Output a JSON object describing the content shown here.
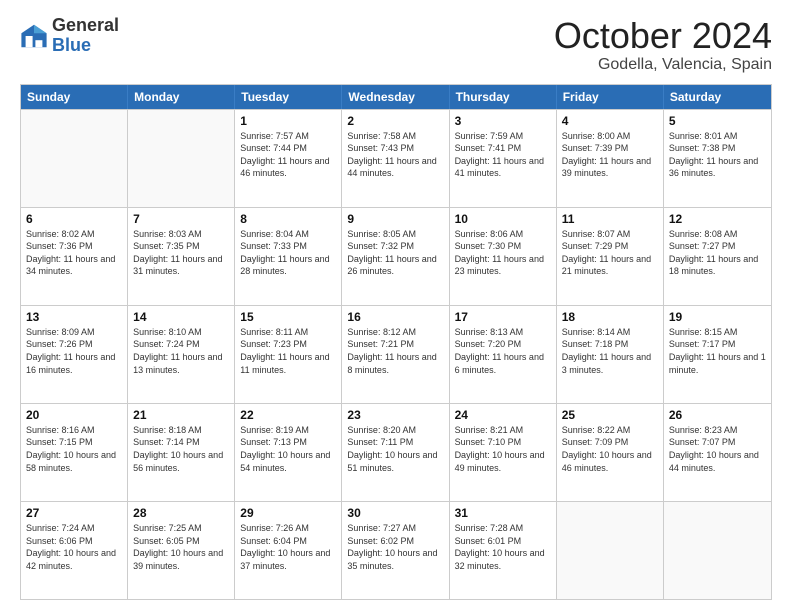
{
  "logo": {
    "general": "General",
    "blue": "Blue"
  },
  "title": "October 2024",
  "location": "Godella, Valencia, Spain",
  "header_days": [
    "Sunday",
    "Monday",
    "Tuesday",
    "Wednesday",
    "Thursday",
    "Friday",
    "Saturday"
  ],
  "rows": [
    [
      {
        "day": "",
        "info": ""
      },
      {
        "day": "",
        "info": ""
      },
      {
        "day": "1",
        "info": "Sunrise: 7:57 AM\nSunset: 7:44 PM\nDaylight: 11 hours and 46 minutes."
      },
      {
        "day": "2",
        "info": "Sunrise: 7:58 AM\nSunset: 7:43 PM\nDaylight: 11 hours and 44 minutes."
      },
      {
        "day": "3",
        "info": "Sunrise: 7:59 AM\nSunset: 7:41 PM\nDaylight: 11 hours and 41 minutes."
      },
      {
        "day": "4",
        "info": "Sunrise: 8:00 AM\nSunset: 7:39 PM\nDaylight: 11 hours and 39 minutes."
      },
      {
        "day": "5",
        "info": "Sunrise: 8:01 AM\nSunset: 7:38 PM\nDaylight: 11 hours and 36 minutes."
      }
    ],
    [
      {
        "day": "6",
        "info": "Sunrise: 8:02 AM\nSunset: 7:36 PM\nDaylight: 11 hours and 34 minutes."
      },
      {
        "day": "7",
        "info": "Sunrise: 8:03 AM\nSunset: 7:35 PM\nDaylight: 11 hours and 31 minutes."
      },
      {
        "day": "8",
        "info": "Sunrise: 8:04 AM\nSunset: 7:33 PM\nDaylight: 11 hours and 28 minutes."
      },
      {
        "day": "9",
        "info": "Sunrise: 8:05 AM\nSunset: 7:32 PM\nDaylight: 11 hours and 26 minutes."
      },
      {
        "day": "10",
        "info": "Sunrise: 8:06 AM\nSunset: 7:30 PM\nDaylight: 11 hours and 23 minutes."
      },
      {
        "day": "11",
        "info": "Sunrise: 8:07 AM\nSunset: 7:29 PM\nDaylight: 11 hours and 21 minutes."
      },
      {
        "day": "12",
        "info": "Sunrise: 8:08 AM\nSunset: 7:27 PM\nDaylight: 11 hours and 18 minutes."
      }
    ],
    [
      {
        "day": "13",
        "info": "Sunrise: 8:09 AM\nSunset: 7:26 PM\nDaylight: 11 hours and 16 minutes."
      },
      {
        "day": "14",
        "info": "Sunrise: 8:10 AM\nSunset: 7:24 PM\nDaylight: 11 hours and 13 minutes."
      },
      {
        "day": "15",
        "info": "Sunrise: 8:11 AM\nSunset: 7:23 PM\nDaylight: 11 hours and 11 minutes."
      },
      {
        "day": "16",
        "info": "Sunrise: 8:12 AM\nSunset: 7:21 PM\nDaylight: 11 hours and 8 minutes."
      },
      {
        "day": "17",
        "info": "Sunrise: 8:13 AM\nSunset: 7:20 PM\nDaylight: 11 hours and 6 minutes."
      },
      {
        "day": "18",
        "info": "Sunrise: 8:14 AM\nSunset: 7:18 PM\nDaylight: 11 hours and 3 minutes."
      },
      {
        "day": "19",
        "info": "Sunrise: 8:15 AM\nSunset: 7:17 PM\nDaylight: 11 hours and 1 minute."
      }
    ],
    [
      {
        "day": "20",
        "info": "Sunrise: 8:16 AM\nSunset: 7:15 PM\nDaylight: 10 hours and 58 minutes."
      },
      {
        "day": "21",
        "info": "Sunrise: 8:18 AM\nSunset: 7:14 PM\nDaylight: 10 hours and 56 minutes."
      },
      {
        "day": "22",
        "info": "Sunrise: 8:19 AM\nSunset: 7:13 PM\nDaylight: 10 hours and 54 minutes."
      },
      {
        "day": "23",
        "info": "Sunrise: 8:20 AM\nSunset: 7:11 PM\nDaylight: 10 hours and 51 minutes."
      },
      {
        "day": "24",
        "info": "Sunrise: 8:21 AM\nSunset: 7:10 PM\nDaylight: 10 hours and 49 minutes."
      },
      {
        "day": "25",
        "info": "Sunrise: 8:22 AM\nSunset: 7:09 PM\nDaylight: 10 hours and 46 minutes."
      },
      {
        "day": "26",
        "info": "Sunrise: 8:23 AM\nSunset: 7:07 PM\nDaylight: 10 hours and 44 minutes."
      }
    ],
    [
      {
        "day": "27",
        "info": "Sunrise: 7:24 AM\nSunset: 6:06 PM\nDaylight: 10 hours and 42 minutes."
      },
      {
        "day": "28",
        "info": "Sunrise: 7:25 AM\nSunset: 6:05 PM\nDaylight: 10 hours and 39 minutes."
      },
      {
        "day": "29",
        "info": "Sunrise: 7:26 AM\nSunset: 6:04 PM\nDaylight: 10 hours and 37 minutes."
      },
      {
        "day": "30",
        "info": "Sunrise: 7:27 AM\nSunset: 6:02 PM\nDaylight: 10 hours and 35 minutes."
      },
      {
        "day": "31",
        "info": "Sunrise: 7:28 AM\nSunset: 6:01 PM\nDaylight: 10 hours and 32 minutes."
      },
      {
        "day": "",
        "info": ""
      },
      {
        "day": "",
        "info": ""
      }
    ]
  ]
}
